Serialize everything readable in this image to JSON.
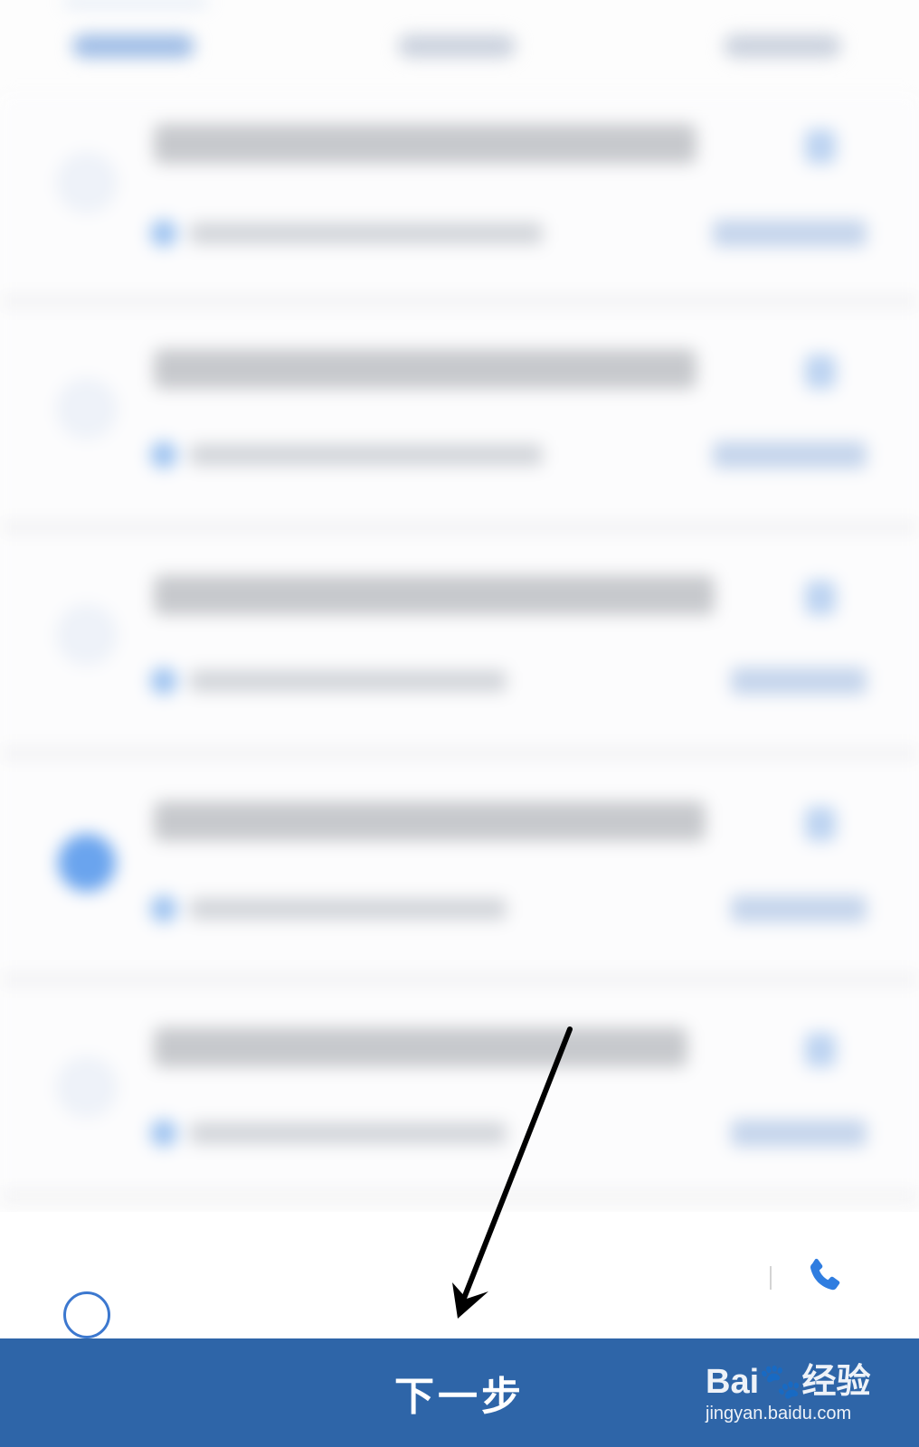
{
  "footer": {
    "next_label": "下一步"
  },
  "icons": {
    "call": "phone-icon",
    "select_all": "radio-circle-icon"
  },
  "watermark": {
    "logo_text": "Bai🐾经验",
    "url": "jingyan.baidu.com"
  },
  "colors": {
    "accent": "#2e65a8",
    "radio_border": "#3c78cf",
    "phone": "#2f7de0",
    "annotation_arrow": "#000000"
  }
}
